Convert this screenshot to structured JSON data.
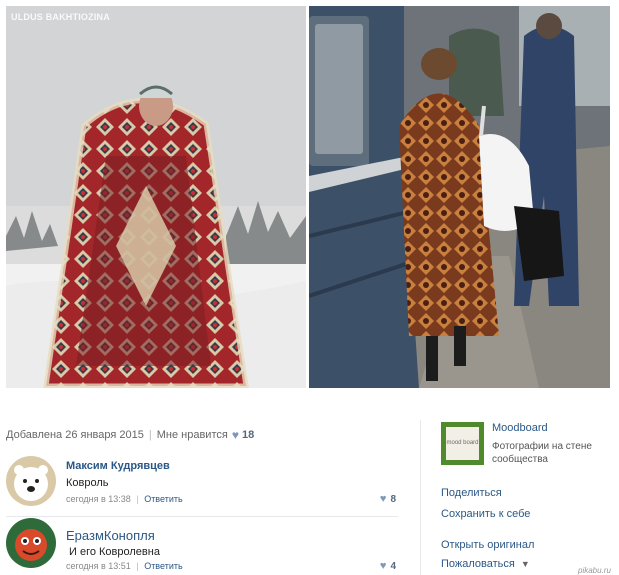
{
  "photos": {
    "left": {
      "watermark": "ULDUS BAKHTIOZINA"
    },
    "right": {}
  },
  "post_meta": {
    "date_text": "Добавлена 26 января 2015",
    "like_label": "Мне нравится",
    "like_count": "18"
  },
  "comments": [
    {
      "author": "Максим Кудрявцев",
      "text": "Ковроль",
      "time": "сегодня в 13:38",
      "reply_label": "Ответить",
      "likes": "8"
    },
    {
      "author": "ЕразмКонопля",
      "text": "И его Ковролевна",
      "time": "сегодня в 13:51",
      "reply_label": "Ответить",
      "likes": "4"
    }
  ],
  "album": {
    "name": "Moodboard",
    "subtitle": "Фотографии на стене сообщества",
    "thumb_text": "mood board"
  },
  "actions": {
    "share": "Поделиться",
    "save": "Сохранить к себе",
    "open_original": "Открыть оригинал",
    "report": "Пожаловаться"
  },
  "source_mark": "pikabu.ru",
  "colors": {
    "link": "#2a5885",
    "heart": "#7d99b7",
    "album_green": "#4f8a2d"
  }
}
